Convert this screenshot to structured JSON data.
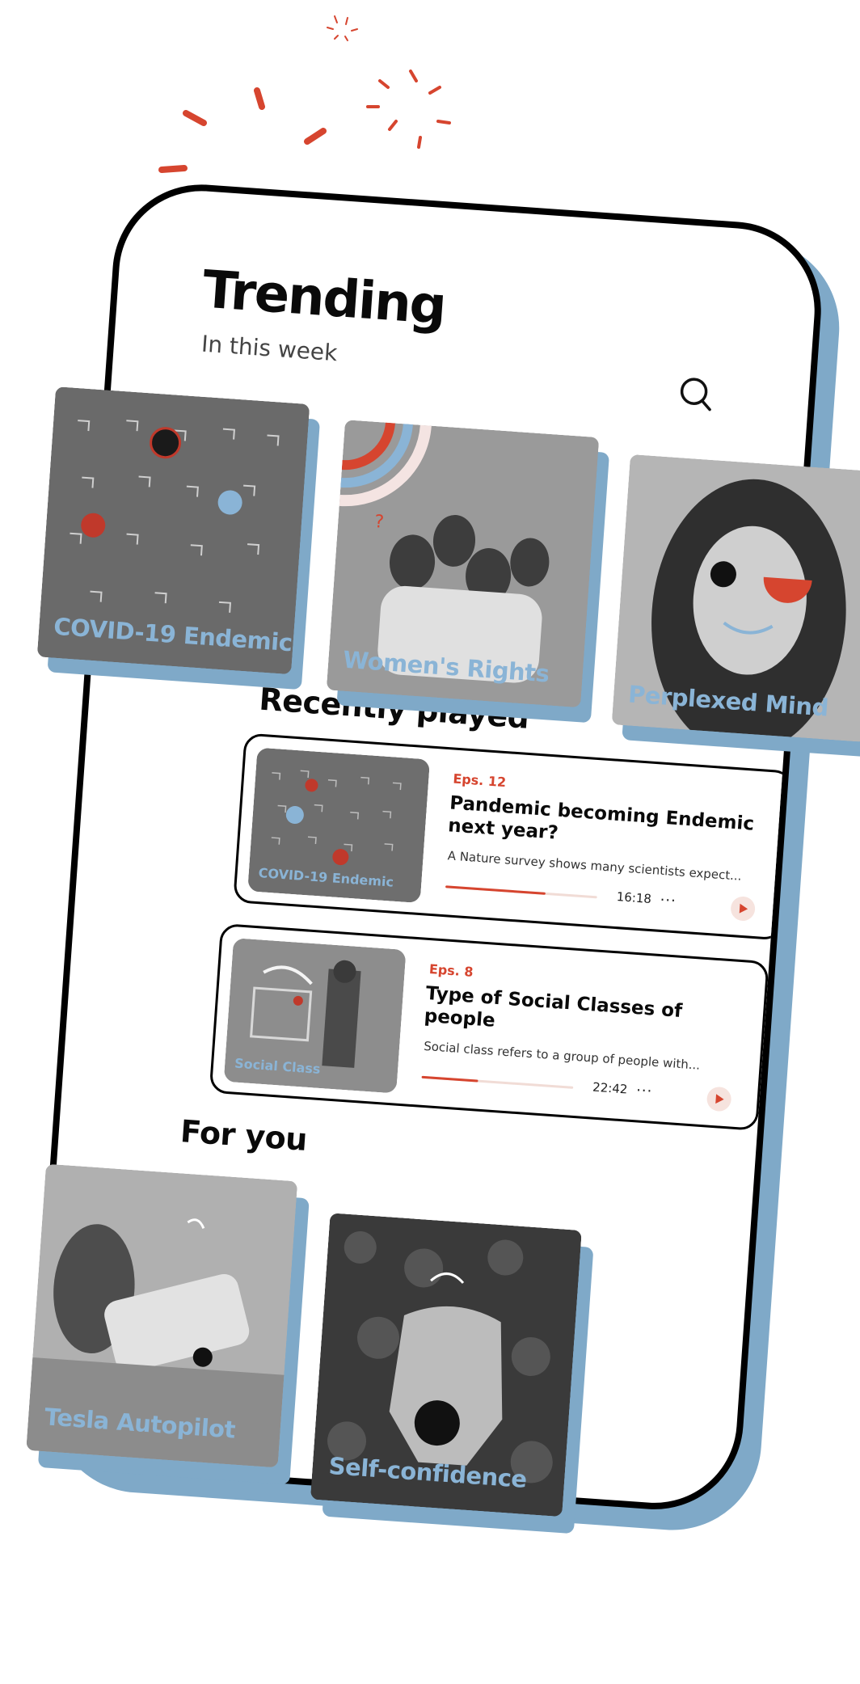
{
  "colors": {
    "accent": "#d6452f",
    "shadow_blue": "#7fa9c8",
    "label_blue": "#8ab4d6",
    "ink": "#0a0a0a"
  },
  "header": {
    "title": "Trending",
    "subtitle": "In this week",
    "search_icon": "search-icon"
  },
  "trending": [
    {
      "label": "COVID-19 Endemic"
    },
    {
      "label": "Women's Rights"
    },
    {
      "label": "Perplexed Mind"
    }
  ],
  "recent": {
    "title": "Recently played",
    "items": [
      {
        "thumb_label": "COVID-19 Endemic",
        "eps": "Eps. 12",
        "title": "Pandemic becoming Endemic next year?",
        "desc": "A Nature survey shows many scientists expect...",
        "time": "16:18",
        "more": "...",
        "progress": 0.66
      },
      {
        "thumb_label": "Social Class",
        "eps": "Eps. 8",
        "title": "Type of Social Classes of people",
        "desc": "Social class refers to a group of people with...",
        "time": "22:42",
        "more": "...",
        "progress": 0.37
      }
    ]
  },
  "for_you": {
    "title": "For you",
    "items": [
      {
        "label": "Tesla Autopilot"
      },
      {
        "label": "Self-confidence"
      }
    ]
  }
}
